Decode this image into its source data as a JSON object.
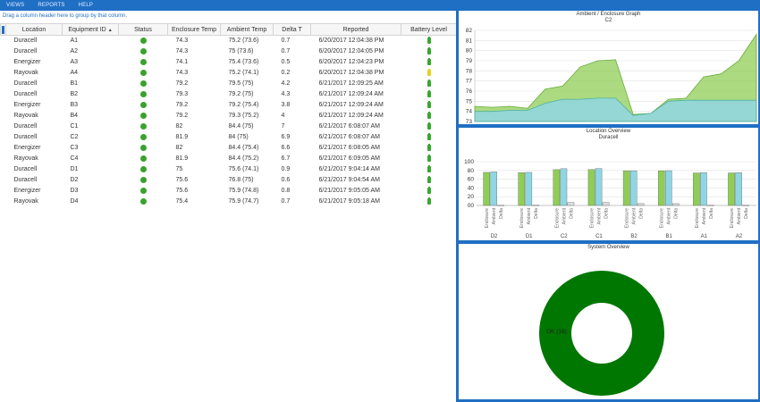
{
  "menu": [
    "VIEWS",
    "REPORTS",
    "HELP"
  ],
  "group_hint": "Drag a column header here to group by that column.",
  "columns": [
    "Location",
    "Equipment ID",
    "Status",
    "Enclosure Temp",
    "Ambient Temp",
    "Delta T",
    "Reported",
    "Battery Level"
  ],
  "colors": {
    "accent": "#1f6fc4",
    "status_ok": "#3aa12c",
    "battery_ok": "#37a82e",
    "battery_warn": "#e6d01e",
    "enclosure": "#8fce55",
    "ambient": "#8fd6e4",
    "donut": "#007700"
  },
  "rows": [
    {
      "location": "Duracell",
      "id": "A1",
      "status": "ok",
      "enc": "74.3",
      "amb": "75.2 (73.6)",
      "delta": "0.7",
      "reported": "6/20/2017 12:04:38 PM",
      "battery": "ok"
    },
    {
      "location": "Duracell",
      "id": "A2",
      "status": "ok",
      "enc": "74.3",
      "amb": "75 (73.6)",
      "delta": "0.7",
      "reported": "6/20/2017 12:04:05 PM",
      "battery": "ok"
    },
    {
      "location": "Energizer",
      "id": "A3",
      "status": "ok",
      "enc": "74.1",
      "amb": "75.4 (73.6)",
      "delta": "0.5",
      "reported": "6/20/2017 12:04:23 PM",
      "battery": "ok"
    },
    {
      "location": "Rayovak",
      "id": "A4",
      "status": "ok",
      "enc": "74.3",
      "amb": "75.2 (74.1)",
      "delta": "0.2",
      "reported": "6/20/2017 12:04:38 PM",
      "battery": "warn"
    },
    {
      "location": "Duracell",
      "id": "B1",
      "status": "ok",
      "enc": "79.2",
      "amb": "79.5 (75)",
      "delta": "4.2",
      "reported": "6/21/2017 12:09:25 AM",
      "battery": "ok"
    },
    {
      "location": "Duracell",
      "id": "B2",
      "status": "ok",
      "enc": "79.3",
      "amb": "79.2 (75)",
      "delta": "4.3",
      "reported": "6/21/2017 12:09:24 AM",
      "battery": "ok"
    },
    {
      "location": "Energizer",
      "id": "B3",
      "status": "ok",
      "enc": "79.2",
      "amb": "79.2 (75.4)",
      "delta": "3.8",
      "reported": "6/21/2017 12:09:24 AM",
      "battery": "ok"
    },
    {
      "location": "Rayovak",
      "id": "B4",
      "status": "ok",
      "enc": "79.2",
      "amb": "79.3 (75.2)",
      "delta": "4",
      "reported": "6/21/2017 12:09:24 AM",
      "battery": "ok"
    },
    {
      "location": "Duracell",
      "id": "C1",
      "status": "ok",
      "enc": "82",
      "amb": "84.4 (75)",
      "delta": "7",
      "reported": "6/21/2017 6:08:07 AM",
      "battery": "ok"
    },
    {
      "location": "Duracell",
      "id": "C2",
      "status": "ok",
      "enc": "81.9",
      "amb": "84 (75)",
      "delta": "6.9",
      "reported": "6/21/2017 6:08:07 AM",
      "battery": "ok"
    },
    {
      "location": "Energizer",
      "id": "C3",
      "status": "ok",
      "enc": "82",
      "amb": "84.4 (75.4)",
      "delta": "6.6",
      "reported": "6/21/2017 6:08:05 AM",
      "battery": "ok"
    },
    {
      "location": "Rayovak",
      "id": "C4",
      "status": "ok",
      "enc": "81.9",
      "amb": "84.4 (75.2)",
      "delta": "6.7",
      "reported": "6/21/2017 6:09:05 AM",
      "battery": "ok"
    },
    {
      "location": "Duracell",
      "id": "D1",
      "status": "ok",
      "enc": "75",
      "amb": "75.6 (74.1)",
      "delta": "0.9",
      "reported": "6/21/2017 9:04:14 AM",
      "battery": "ok"
    },
    {
      "location": "Duracell",
      "id": "D2",
      "status": "ok",
      "enc": "75.6",
      "amb": "76.8 (75)",
      "delta": "0.6",
      "reported": "6/21/2017 9:04:54 AM",
      "battery": "ok"
    },
    {
      "location": "Energizer",
      "id": "D3",
      "status": "ok",
      "enc": "75.6",
      "amb": "75.9 (74.8)",
      "delta": "0.8",
      "reported": "6/21/2017 9:05:05 AM",
      "battery": "ok"
    },
    {
      "location": "Rayovak",
      "id": "D4",
      "status": "ok",
      "enc": "75.4",
      "amb": "75.9 (74.7)",
      "delta": "0.7",
      "reported": "6/21/2017 9:05:18 AM",
      "battery": "ok"
    }
  ],
  "charts": {
    "area": {
      "title": "Ambient / Enclosure Graph",
      "subtitle": "C2"
    },
    "bar": {
      "title": "Location Overview",
      "subtitle": "Duracell"
    },
    "donut": {
      "title": "System Overview",
      "label": "OK (16)"
    }
  },
  "chart_data": [
    {
      "type": "area",
      "title": "Ambient / Enclosure Graph",
      "subtitle": "C2",
      "ylim": [
        73,
        82
      ],
      "yticks": [
        73,
        74,
        75,
        76,
        77,
        78,
        79,
        80,
        81,
        82
      ],
      "grid": true,
      "series": [
        {
          "values": [
            74.5,
            74.4,
            74.5,
            74.3,
            76.2,
            76.5,
            78.4,
            79.0,
            79.1,
            73.7,
            73.8,
            75.2,
            75.3,
            77.4,
            77.7,
            79.0,
            81.6
          ]
        },
        {
          "values": [
            74.0,
            74.0,
            74.1,
            74.1,
            74.8,
            75.2,
            75.2,
            75.3,
            75.3,
            73.6,
            73.8,
            75.0,
            75.1,
            75.1,
            75.1,
            75.1,
            75.1
          ]
        }
      ]
    },
    {
      "type": "bar",
      "title": "Location Overview",
      "subtitle": "Duracell",
      "ylim": [
        0,
        100
      ],
      "yticks": [
        "00",
        20,
        40,
        60,
        80,
        100
      ],
      "bar_labels": [
        "Enclosure",
        "Ambient",
        "Delta"
      ],
      "categories": [
        "D2",
        "D1",
        "C2",
        "C1",
        "B2",
        "B1",
        "A1",
        "A2"
      ],
      "values": [
        [
          75.6,
          76.8,
          0.6
        ],
        [
          75,
          75.6,
          0.9
        ],
        [
          81.9,
          84,
          6.9
        ],
        [
          82,
          84.4,
          7
        ],
        [
          79.3,
          79.2,
          4.3
        ],
        [
          79.2,
          79.5,
          4.2
        ],
        [
          74.3,
          75.2,
          0.7
        ],
        [
          74.3,
          75,
          0.7
        ]
      ]
    },
    {
      "type": "pie",
      "title": "System Overview",
      "slices": [
        {
          "label": "OK (16)",
          "value": 16,
          "color": "#007700"
        }
      ]
    }
  ]
}
